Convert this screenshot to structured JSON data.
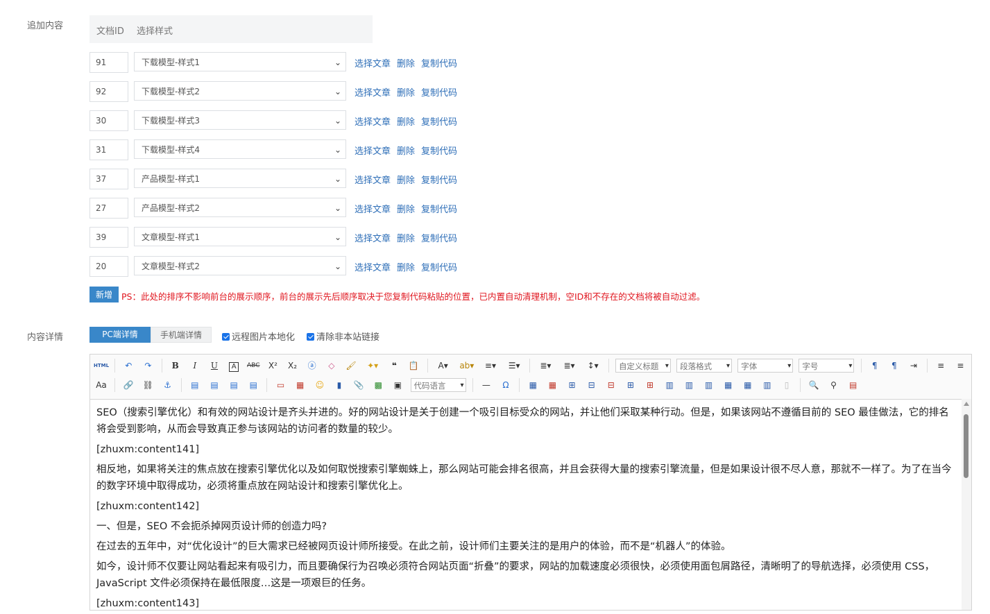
{
  "append_section": {
    "label": "追加内容",
    "header_doc_id": "文档ID",
    "header_style": "选择样式",
    "rows": [
      {
        "id": "91",
        "style": "下载模型-样式1"
      },
      {
        "id": "92",
        "style": "下载模型-样式2"
      },
      {
        "id": "30",
        "style": "下载模型-样式3"
      },
      {
        "id": "31",
        "style": "下载模型-样式4"
      },
      {
        "id": "37",
        "style": "产品模型-样式1"
      },
      {
        "id": "27",
        "style": "产品模型-样式2"
      },
      {
        "id": "39",
        "style": "文章模型-样式1"
      },
      {
        "id": "20",
        "style": "文章模型-样式2"
      }
    ],
    "action_select": "选择文章",
    "action_delete": "删除",
    "action_copy": "复制代码",
    "add_button": "新增",
    "note": "PS：此处的排序不影响前台的展示顺序，前台的展示先后顺序取决于您复制代码粘贴的位置，已内置自动清理机制，空ID和不存在的文档将被自动过滤。"
  },
  "detail_section": {
    "label": "内容详情",
    "tab_pc": "PC端详情",
    "tab_mobile": "手机端详情",
    "checkbox_remote_images": "远程图片本地化",
    "checkbox_clear_links": "清除非本站链接",
    "toolbar": {
      "html_label": "HTML",
      "custom_title": "自定义标题",
      "paragraph_format": "段落格式",
      "font_family": "字体",
      "font_size": "字号",
      "code_language": "代码语言"
    },
    "content_lines": [
      "SEO（搜索引擎优化）和有效的网站设计是齐头并进的。好的网站设计是关于创建一个吸引目标受众的网站，并让他们采取某种行动。但是，如果该网站不遵循目前的 SEO 最佳做法，它的排名将会受到影响，从而会导致真正参与该网站的访问者的数量的较少。",
      "[zhuxm:content141]",
      "相反地，如果将关注的焦点放在搜索引擎优化以及如何取悦搜索引擎蜘蛛上，那么网站可能会排名很高，并且会获得大量的搜索引擎流量，但是如果设计很不尽人意，那就不一样了。为了在当今的数字环境中取得成功，必须将重点放在网站设计和搜索引擎优化上。",
      "[zhuxm:content142]",
      "一、但是，SEO 不会扼杀掉网页设计师的创造力吗?",
      "在过去的五年中，对“优化设计”的巨大需求已经被网页设计师所接受。在此之前，设计师们主要关注的是用户的体验，而不是“机器人”的体验。",
      "如今，设计师不仅要让网站看起来有吸引力，而且要确保行为召唤必须符合网站页面“折叠”的要求，网站的加载速度必须很快，必须使用面包屑路径，清晰明了的导航选择，必须使用 CSS，JavaScript 文件必须保持在最低限度…这是一项艰巨的任务。",
      "[zhuxm:content143]"
    ]
  }
}
